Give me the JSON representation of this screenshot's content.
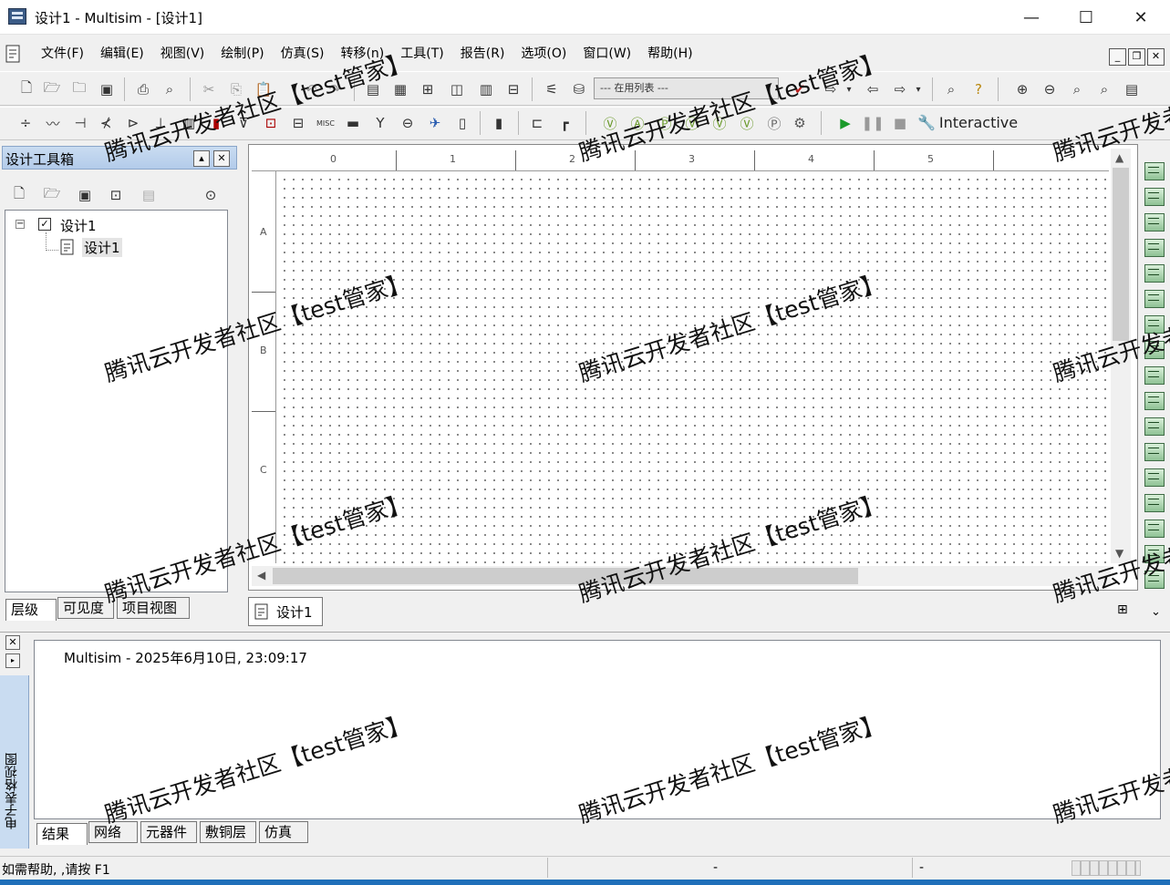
{
  "window": {
    "title": "设计1 - Multisim - [设计1]",
    "minimize": "—",
    "maximize": "☐",
    "close": "✕"
  },
  "menu": {
    "items": [
      "文件(F)",
      "编辑(E)",
      "视图(V)",
      "绘制(P)",
      "仿真(S)",
      "转移(n)",
      "工具(T)",
      "报告(R)",
      "选项(O)",
      "窗口(W)",
      "帮助(H)"
    ]
  },
  "mdi": {
    "minimize": "_",
    "restore": "❐",
    "close": "✕"
  },
  "toolbar": {
    "inuse_list": "--- 在用列表 ---",
    "interactive_label": "Interactive"
  },
  "toolbox": {
    "title": "设计工具箱",
    "tree": {
      "root": "设计1",
      "child": "设计1"
    },
    "tabs": [
      "层级",
      "可见度",
      "项目视图"
    ]
  },
  "canvas": {
    "col_labels": [
      "0",
      "1",
      "2",
      "3",
      "4",
      "5"
    ],
    "row_labels": [
      "A",
      "B",
      "C"
    ],
    "tab_label": "设计1"
  },
  "spreadsheet": {
    "side_label": "电子表格视图",
    "result_line": "Multisim  -  2025年6月10日, 23:09:17",
    "tabs": [
      "结果",
      "网络",
      "元器件",
      "敷铜层",
      "仿真"
    ]
  },
  "status": {
    "help_text": "如需帮助, ,请按 F1",
    "dash1": "-",
    "dash2": "-"
  },
  "watermark": {
    "text": "腾讯云开发者社区【test管家】",
    "text_cut": "腾讯云开发者"
  }
}
